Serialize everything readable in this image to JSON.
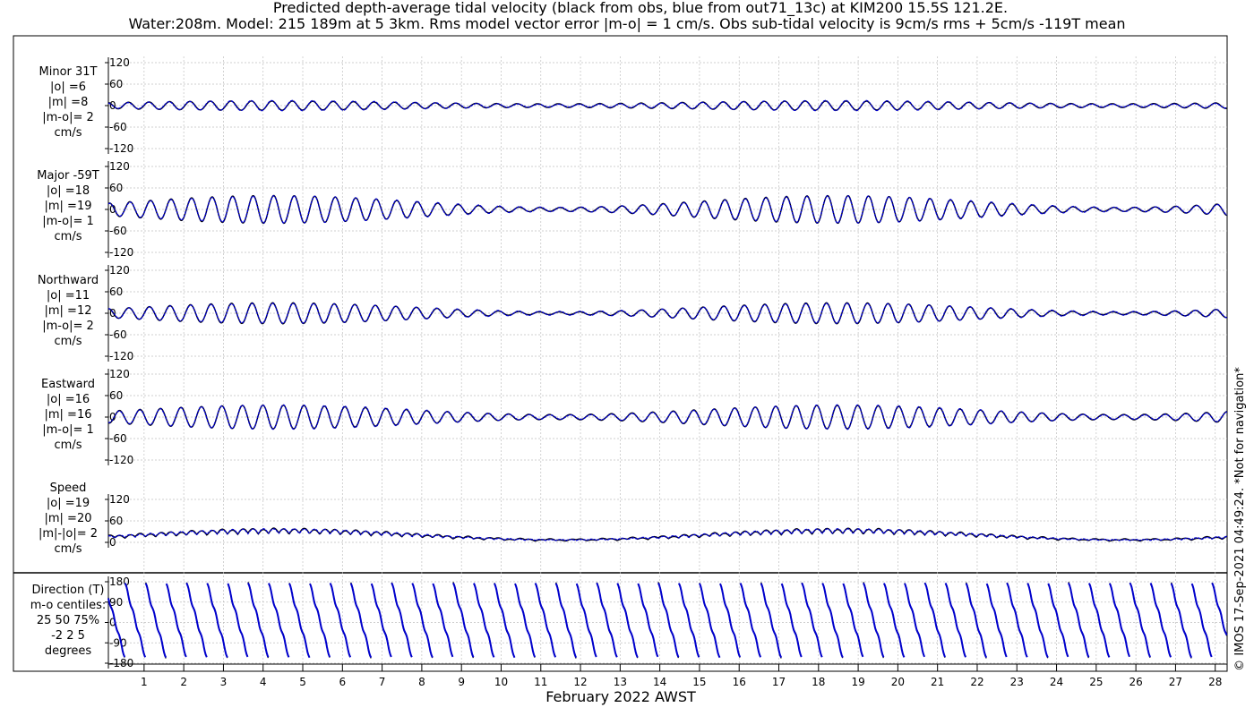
{
  "header": {
    "title_line1": "Predicted depth-average tidal velocity (black from obs, blue from out71_13c) at KIM200 15.5S 121.2E.",
    "title_line2": "Water:208m. Model: 215 189m at 5 3km. Rms model vector error |m-o| = 1 cm/s. Obs sub-tidal velocity is 9cm/s rms + 5cm/s -119T mean"
  },
  "footer": {
    "xlabel": "February 2022 AWST",
    "watermark": "© IMOS 17-Sep-2021 04:49:24. *Not for navigation*"
  },
  "colors": {
    "obs": "#000000",
    "model": "#0000cc",
    "grid": "#c0c0c0"
  },
  "chart_data": {
    "type": "line",
    "x_axis": {
      "label": "February 2022 AWST",
      "range_days": [
        0.1,
        28.3
      ],
      "ticks": [
        1,
        2,
        3,
        4,
        5,
        6,
        7,
        8,
        9,
        10,
        11,
        12,
        13,
        14,
        15,
        16,
        17,
        18,
        19,
        20,
        21,
        22,
        23,
        24,
        25,
        26,
        27,
        28
      ]
    },
    "series_legend": [
      "obs (black)",
      "model out71_13c (blue)"
    ],
    "panels": [
      {
        "id": "minor",
        "labels": [
          "Minor 31T",
          "|o| =6",
          "|m| =8",
          "|m-o|= 2",
          "cm/s"
        ],
        "ylim": [
          -120,
          120
        ],
        "yticks": [
          120,
          60,
          0,
          -60,
          -120
        ],
        "amplitude_spring": 14,
        "amplitude_neap": 4,
        "phase": 0.6
      },
      {
        "id": "major",
        "labels": [
          "Major -59T",
          "|o| =18",
          "|m| =19",
          "|m-o|= 1",
          "cm/s"
        ],
        "ylim": [
          -120,
          120
        ],
        "yticks": [
          120,
          60,
          0,
          -60,
          -120
        ],
        "amplitude_spring": 38,
        "amplitude_neap": 6,
        "phase": 0.0
      },
      {
        "id": "northward",
        "labels": [
          "Northward",
          "|o| =11",
          "|m| =12",
          "|m-o|= 2",
          "cm/s"
        ],
        "ylim": [
          -120,
          120
        ],
        "yticks": [
          120,
          60,
          0,
          -60,
          -120
        ],
        "amplitude_spring": 28,
        "amplitude_neap": 5,
        "phase": 0.3
      },
      {
        "id": "eastward",
        "labels": [
          "Eastward",
          "|o| =16",
          "|m| =16",
          "|m-o|= 1",
          "cm/s"
        ],
        "ylim": [
          -120,
          120
        ],
        "yticks": [
          120,
          60,
          0,
          -60,
          -120
        ],
        "amplitude_spring": 34,
        "amplitude_neap": 6,
        "phase": 3.3
      },
      {
        "id": "speed",
        "labels": [
          "Speed",
          "|o| =19",
          "|m| =20",
          "|m|-|o|= 2",
          "cm/s"
        ],
        "ylim": [
          0,
          120
        ],
        "yticks": [
          120,
          60,
          0
        ],
        "amplitude_spring": 38,
        "amplitude_neap": 8,
        "phase": 0.0
      },
      {
        "id": "direction",
        "labels": [
          "Direction (T)",
          "m-o centiles:",
          "25  50  75%",
          "-2  2  5",
          "degrees"
        ],
        "ylim": [
          -180,
          180
        ],
        "yticks": [
          180,
          90,
          0,
          -90,
          -180
        ]
      }
    ],
    "tidal_period_days": 0.517,
    "spring_neap_period_days": 14.2,
    "neap_days": [
      11.5,
      25.8
    ]
  }
}
